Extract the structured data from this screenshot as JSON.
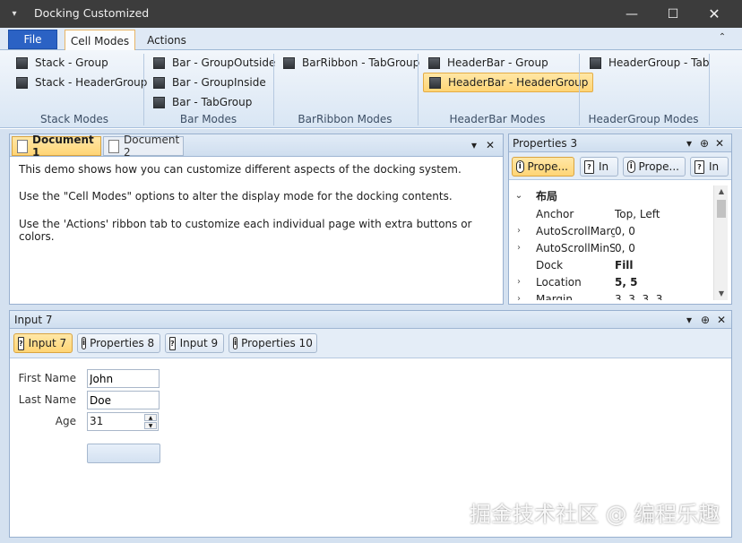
{
  "window": {
    "title": "Docking Customized"
  },
  "ribbon_tabs": {
    "file": "File",
    "cell_modes": "Cell Modes",
    "actions": "Actions"
  },
  "ribbon": {
    "stack": {
      "btn1": "Stack - Group",
      "btn2": "Stack - HeaderGroup",
      "label": "Stack Modes"
    },
    "bar": {
      "btn1": "Bar - GroupOutside",
      "btn2": "Bar - GroupInside",
      "btn3": "Bar - TabGroup",
      "label": "Bar Modes"
    },
    "barribbon": {
      "btn1": "BarRibbon - TabGroup",
      "label": "BarRibbon Modes"
    },
    "headerbar": {
      "btn1": "HeaderBar - Group",
      "btn2": "HeaderBar - HeaderGroup",
      "label": "HeaderBar Modes"
    },
    "headergroup": {
      "btn1": "HeaderGroup - Tab",
      "label": "HeaderGroup Modes"
    }
  },
  "documents": {
    "tabs": [
      "Document 1",
      "Document 2"
    ],
    "lines": [
      "This demo shows how you can customize different aspects of the docking system.",
      "Use the \"Cell Modes\" options to alter the display mode for the docking contents.",
      "Use the 'Actions' ribbon tab to customize each individual page with extra buttons or colors."
    ]
  },
  "properties_panel": {
    "title": "Properties 3",
    "tabs": [
      "Prope...",
      "In",
      "Prope...",
      "In"
    ],
    "category": "布局",
    "rows": [
      {
        "name": "Anchor",
        "value": "Top, Left"
      },
      {
        "name": "AutoScrollMarg",
        "value": "0, 0"
      },
      {
        "name": "AutoScrollMinS",
        "value": "0, 0"
      },
      {
        "name": "Dock",
        "value": "Fill"
      },
      {
        "name": "Location",
        "value": "5, 5"
      },
      {
        "name": "Margin",
        "value": "3, 3, 3, 3"
      }
    ]
  },
  "input_panel": {
    "title": "Input 7",
    "tabs": [
      "Input 7",
      "Properties 8",
      "Input 9",
      "Properties 10"
    ],
    "first_name_label": "First Name",
    "first_name_value": "John",
    "last_name_label": "Last Name",
    "last_name_value": "Doe",
    "age_label": "Age",
    "age_value": "31"
  },
  "watermark": "掘金技术社区 @ 编程乐趣"
}
